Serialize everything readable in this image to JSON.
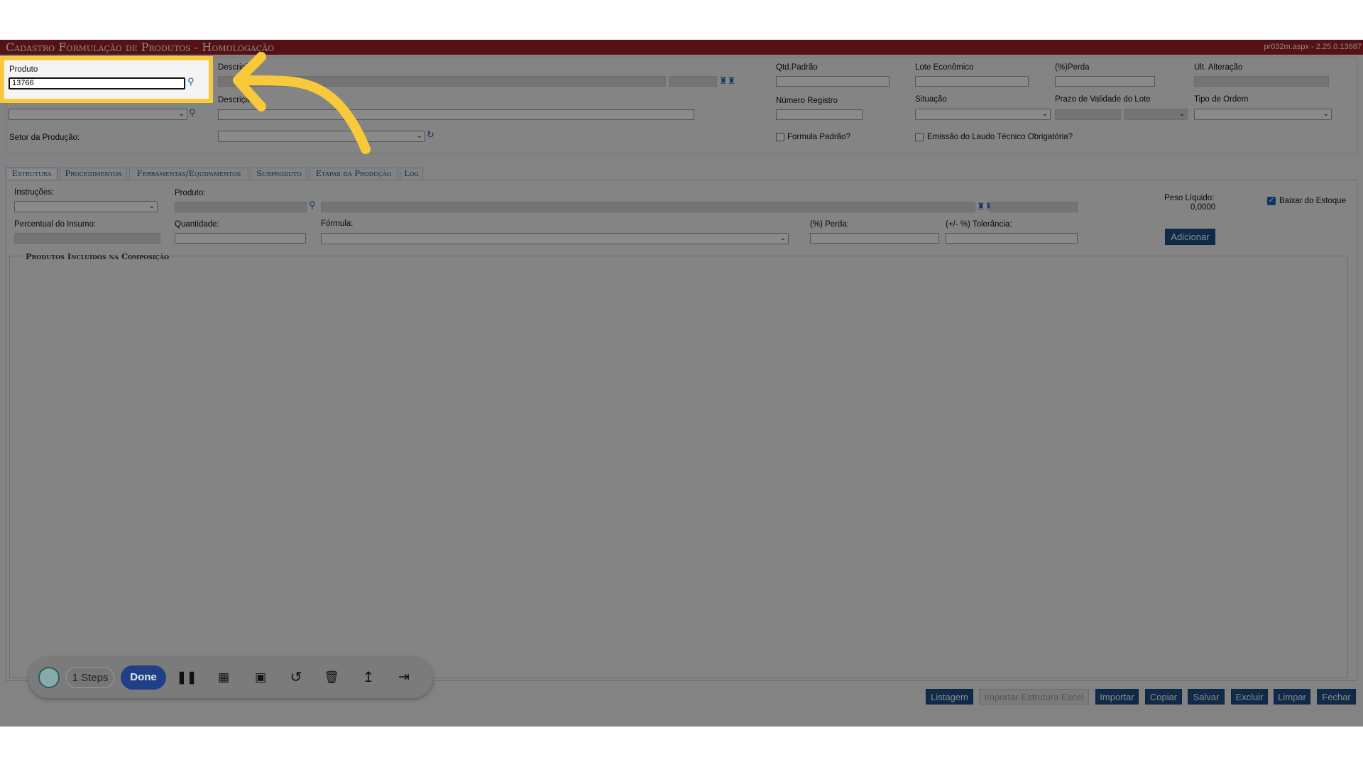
{
  "window": {
    "title": "Cadastro Formulação de Produtos  - Homologação",
    "version": "pr032m.aspx - 2.25.0.13687"
  },
  "header": {
    "produto_label": "Produto",
    "produto_value": "13766",
    "descricao1_label": "Descrição",
    "descricao2_label": "Descrição",
    "setor_label": "Setor da Produção:",
    "qtd_padrao_label": "Qtd.Padrão",
    "lote_economico_label": "Lote Econômico",
    "perda_label": "(%)Perda",
    "ult_alteracao_label": "Ult. Alteração",
    "numero_registro_label": "Número Registro",
    "situacao_label": "Situação",
    "prazo_validade_label": "Prazo de Validade do Lote",
    "tipo_ordem_label": "Tipo de Ordem",
    "formula_padrao_label": "Formula Padrão?",
    "emissao_laudo_label": "Emissão do Laudo Técnico Obrigatória?"
  },
  "tabs": [
    {
      "label": "Estrutura"
    },
    {
      "label": "Procedimentos"
    },
    {
      "label": "Ferramentas/Equipamentos"
    },
    {
      "label": "Subproduto"
    },
    {
      "label": "Etapas da Produção"
    },
    {
      "label": "Log"
    }
  ],
  "estrutura": {
    "instrucoes_label": "Instruções:",
    "produto_label": "Produto:",
    "peso_liquido_label": "Peso Líquido:",
    "peso_liquido_value": "0,0000",
    "baixar_estoque_label": "Baixar do Estoque",
    "baixar_estoque_checked": true,
    "percentual_insumo_label": "Percentual do Insumo:",
    "quantidade_label": "Quantidade:",
    "formula_label": "Fórmula:",
    "perda_label": "(%) Perda:",
    "tolerancia_label": "(+/- %) Tolerância:",
    "adicionar_label": "Adicionar",
    "composicao_legend": "Produtos Incluídos na Composição"
  },
  "footer_buttons": {
    "listagem": "Listagem",
    "importar_estrutura_excel": "Importar Estrutura Excel",
    "importar": "Importar",
    "copiar": "Copiar",
    "salvar": "Salvar",
    "excluir": "Excluir",
    "limpar": "Limpar",
    "fechar": "Fechar"
  },
  "recorder": {
    "steps_label": "1 Steps",
    "done_label": "Done",
    "icons": [
      "recorder-logo-icon",
      "pause-icon",
      "blur-icon",
      "image-icon",
      "undo-icon",
      "trash-icon",
      "branch-icon",
      "skip-to-end-icon"
    ]
  },
  "annotation": {
    "highlight_color": "#f7c93b",
    "arrow_color": "#f7c93b"
  },
  "colors": {
    "title_bar": "#9e2024",
    "primary_button": "#1f4e8a",
    "icon_blue": "#1f66b3"
  }
}
